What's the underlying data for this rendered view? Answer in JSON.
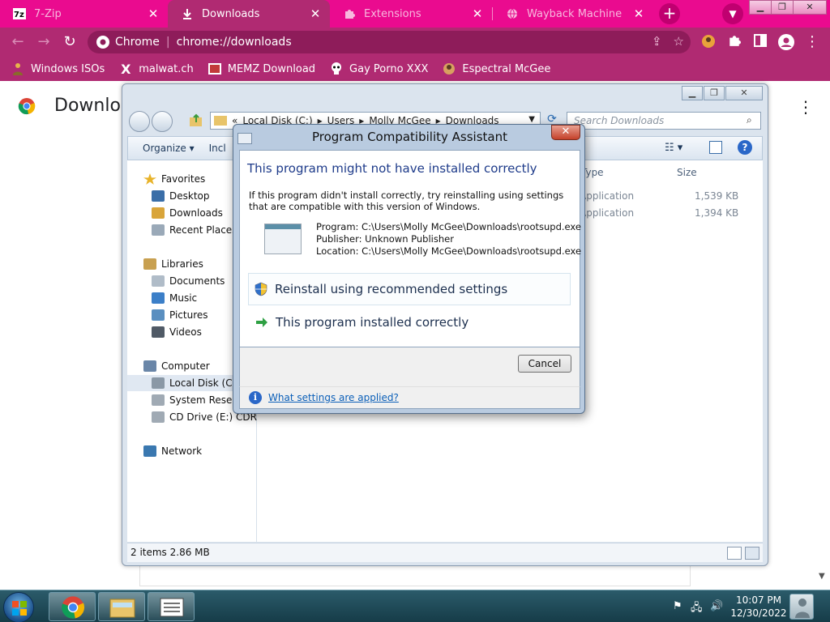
{
  "tabs": [
    {
      "title": "7-Zip",
      "favicon": "7zip-icon",
      "active": false
    },
    {
      "title": "Downloads",
      "favicon": "download-icon",
      "active": true
    },
    {
      "title": "Extensions",
      "favicon": "puzzle-icon",
      "active": false
    },
    {
      "title": "Wayback Machine",
      "favicon": "globe-icon",
      "active": false
    }
  ],
  "omnibox": {
    "site_label": "Chrome",
    "url": "chrome://downloads"
  },
  "bookmarks": [
    {
      "label": "Windows ISOs",
      "icon": "person-icon"
    },
    {
      "label": "malwat.ch",
      "icon": "x-logo-icon"
    },
    {
      "label": "MEMZ Download",
      "icon": "image-icon"
    },
    {
      "label": "Gay Porno XXX",
      "icon": "skull-icon"
    },
    {
      "label": "Espectral McGee",
      "icon": "avatar-icon"
    }
  ],
  "downloads_page": {
    "title": "Downloads"
  },
  "explorer": {
    "breadcrumb": [
      "«",
      "Local Disk (C:)",
      "▸",
      "Users",
      "▸",
      "Molly McGee",
      "▸",
      "Downloads"
    ],
    "search_placeholder": "Search Downloads",
    "commands": [
      "Organize ▾",
      "Incl"
    ],
    "nav": [
      {
        "label": "Favorites",
        "color": "#e8b32a"
      },
      {
        "label": "Desktop",
        "color": "#3a6ea8"
      },
      {
        "label": "Downloads",
        "color": "#d9a53a"
      },
      {
        "label": "Recent Places",
        "color": "#9aa9b8"
      },
      {
        "label": "Libraries",
        "color": "#c8a050"
      },
      {
        "label": "Documents",
        "color": "#b0bcc8"
      },
      {
        "label": "Music",
        "color": "#3c7fc8"
      },
      {
        "label": "Pictures",
        "color": "#5a8fc0"
      },
      {
        "label": "Videos",
        "color": "#505a66"
      },
      {
        "label": "Computer",
        "color": "#6a86a8"
      },
      {
        "label": "Local Disk (C:)",
        "color": "#8a98a6"
      },
      {
        "label": "System Reserved",
        "color": "#a0aab4"
      },
      {
        "label": "CD Drive (E:) CDROM",
        "color": "#a0aab4"
      },
      {
        "label": "Network",
        "color": "#3a78b0"
      }
    ],
    "columns": [
      "Type",
      "Size"
    ],
    "rows": [
      {
        "type": "Application",
        "size": "1,539 KB"
      },
      {
        "type": "Application",
        "size": "1,394 KB"
      }
    ],
    "status": "2 items  2.86 MB"
  },
  "dialog": {
    "title": "Program Compatibility Assistant",
    "heading": "This program might not have installed correctly",
    "description": "If this program didn't install correctly, try reinstalling using settings that are compatible with this version of Windows.",
    "program": "Program: C:\\Users\\Molly McGee\\Downloads\\rootsupd.exe",
    "publisher": "Publisher: Unknown Publisher",
    "location": "Location: C:\\Users\\Molly McGee\\Downloads\\rootsupd.exe",
    "option_reinstall": "Reinstall using recommended settings",
    "option_correct": "This program installed correctly",
    "cancel_label": "Cancel",
    "help_link": "What settings are applied?"
  },
  "taskbar": {
    "time": "10:07 PM",
    "date": "12/30/2022"
  },
  "colors": {
    "tabstrip": "#ea0b8f",
    "toolbar": "#b02a72",
    "dialog_heading": "#1e3b8a",
    "link": "#0b5fb8"
  }
}
